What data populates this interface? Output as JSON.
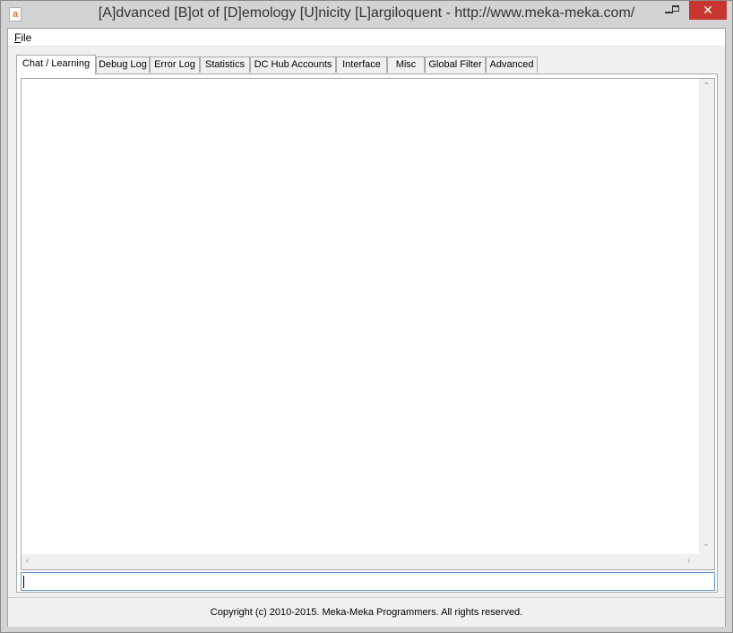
{
  "window": {
    "title": "[A]dvanced [B]ot of [D]emology [U]nicity [L]argiloquent - http://www.meka-meka.com/",
    "icon_letter": "a",
    "close_symbol": "✕"
  },
  "menu": {
    "file_label_accel": "F",
    "file_label_rest": "ile"
  },
  "tabs": [
    {
      "label": "Chat / Learning",
      "active": true
    },
    {
      "label": "Debug Log"
    },
    {
      "label": "Error Log"
    },
    {
      "label": "Statistics"
    },
    {
      "label": "DC Hub Accounts"
    },
    {
      "label": "Interface"
    },
    {
      "label": "Misc"
    },
    {
      "label": "Global Filter"
    },
    {
      "label": "Advanced"
    }
  ],
  "scroll_icons": {
    "up": "⌃",
    "down": "⌄",
    "left": "‹",
    "right": "›"
  },
  "chat": {
    "input_value": ""
  },
  "status": {
    "copyright": "Copyright (c) 2010-2015. Meka-Meka Programmers. All rights reserved."
  }
}
